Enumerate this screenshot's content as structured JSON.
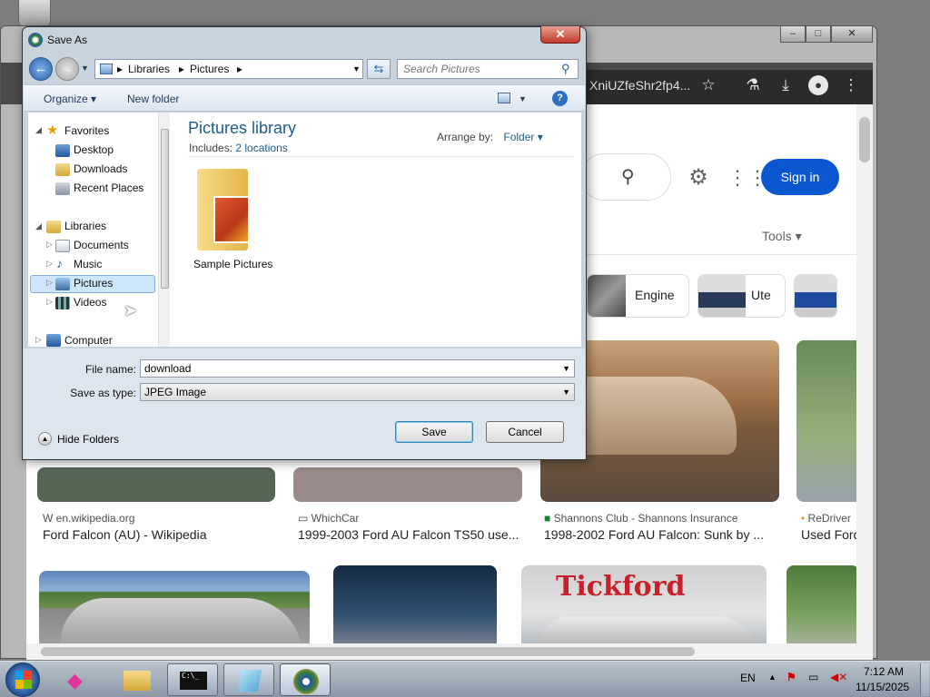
{
  "browser": {
    "address_text": "XniUZfeShr2fp4...",
    "sign_in": "Sign in",
    "tools": "Tools",
    "chips": [
      {
        "label": "Engine"
      },
      {
        "label": "Ute"
      }
    ],
    "results": [
      {
        "source": "en.wikipedia.org",
        "title": "Ford Falcon (AU) - Wikipedia"
      },
      {
        "source": "WhichCar",
        "title": "1999-2003 Ford AU Falcon TS50 use..."
      },
      {
        "source": "Shannons Club - Shannons Insurance",
        "title": "1998-2002 Ford AU Falcon: Sunk by ..."
      },
      {
        "source": "ReDriver",
        "title": "Used Ford"
      }
    ],
    "tickford_sign": "Tickford"
  },
  "dialog": {
    "title": "Save As",
    "path": [
      "Libraries",
      "Pictures"
    ],
    "search_placeholder": "Search Pictures",
    "toolbar": {
      "organize": "Organize",
      "new_folder": "New folder"
    },
    "nav": {
      "favorites": "Favorites",
      "favorites_items": [
        "Desktop",
        "Downloads",
        "Recent Places"
      ],
      "libraries": "Libraries",
      "libraries_items": [
        "Documents",
        "Music",
        "Pictures",
        "Videos"
      ],
      "computer": "Computer"
    },
    "library_title": "Pictures library",
    "includes_label": "Includes:",
    "includes_link": "2 locations",
    "arrange_label": "Arrange by:",
    "arrange_value": "Folder",
    "folder": "Sample Pictures",
    "file_name_label": "File name:",
    "file_name_value": "download",
    "save_type_label": "Save as type:",
    "save_type_value": "JPEG Image",
    "hide_folders": "Hide Folders",
    "save": "Save",
    "cancel": "Cancel"
  },
  "taskbar": {
    "language": "EN",
    "time": "7:12 AM",
    "date": "11/15/2025"
  }
}
